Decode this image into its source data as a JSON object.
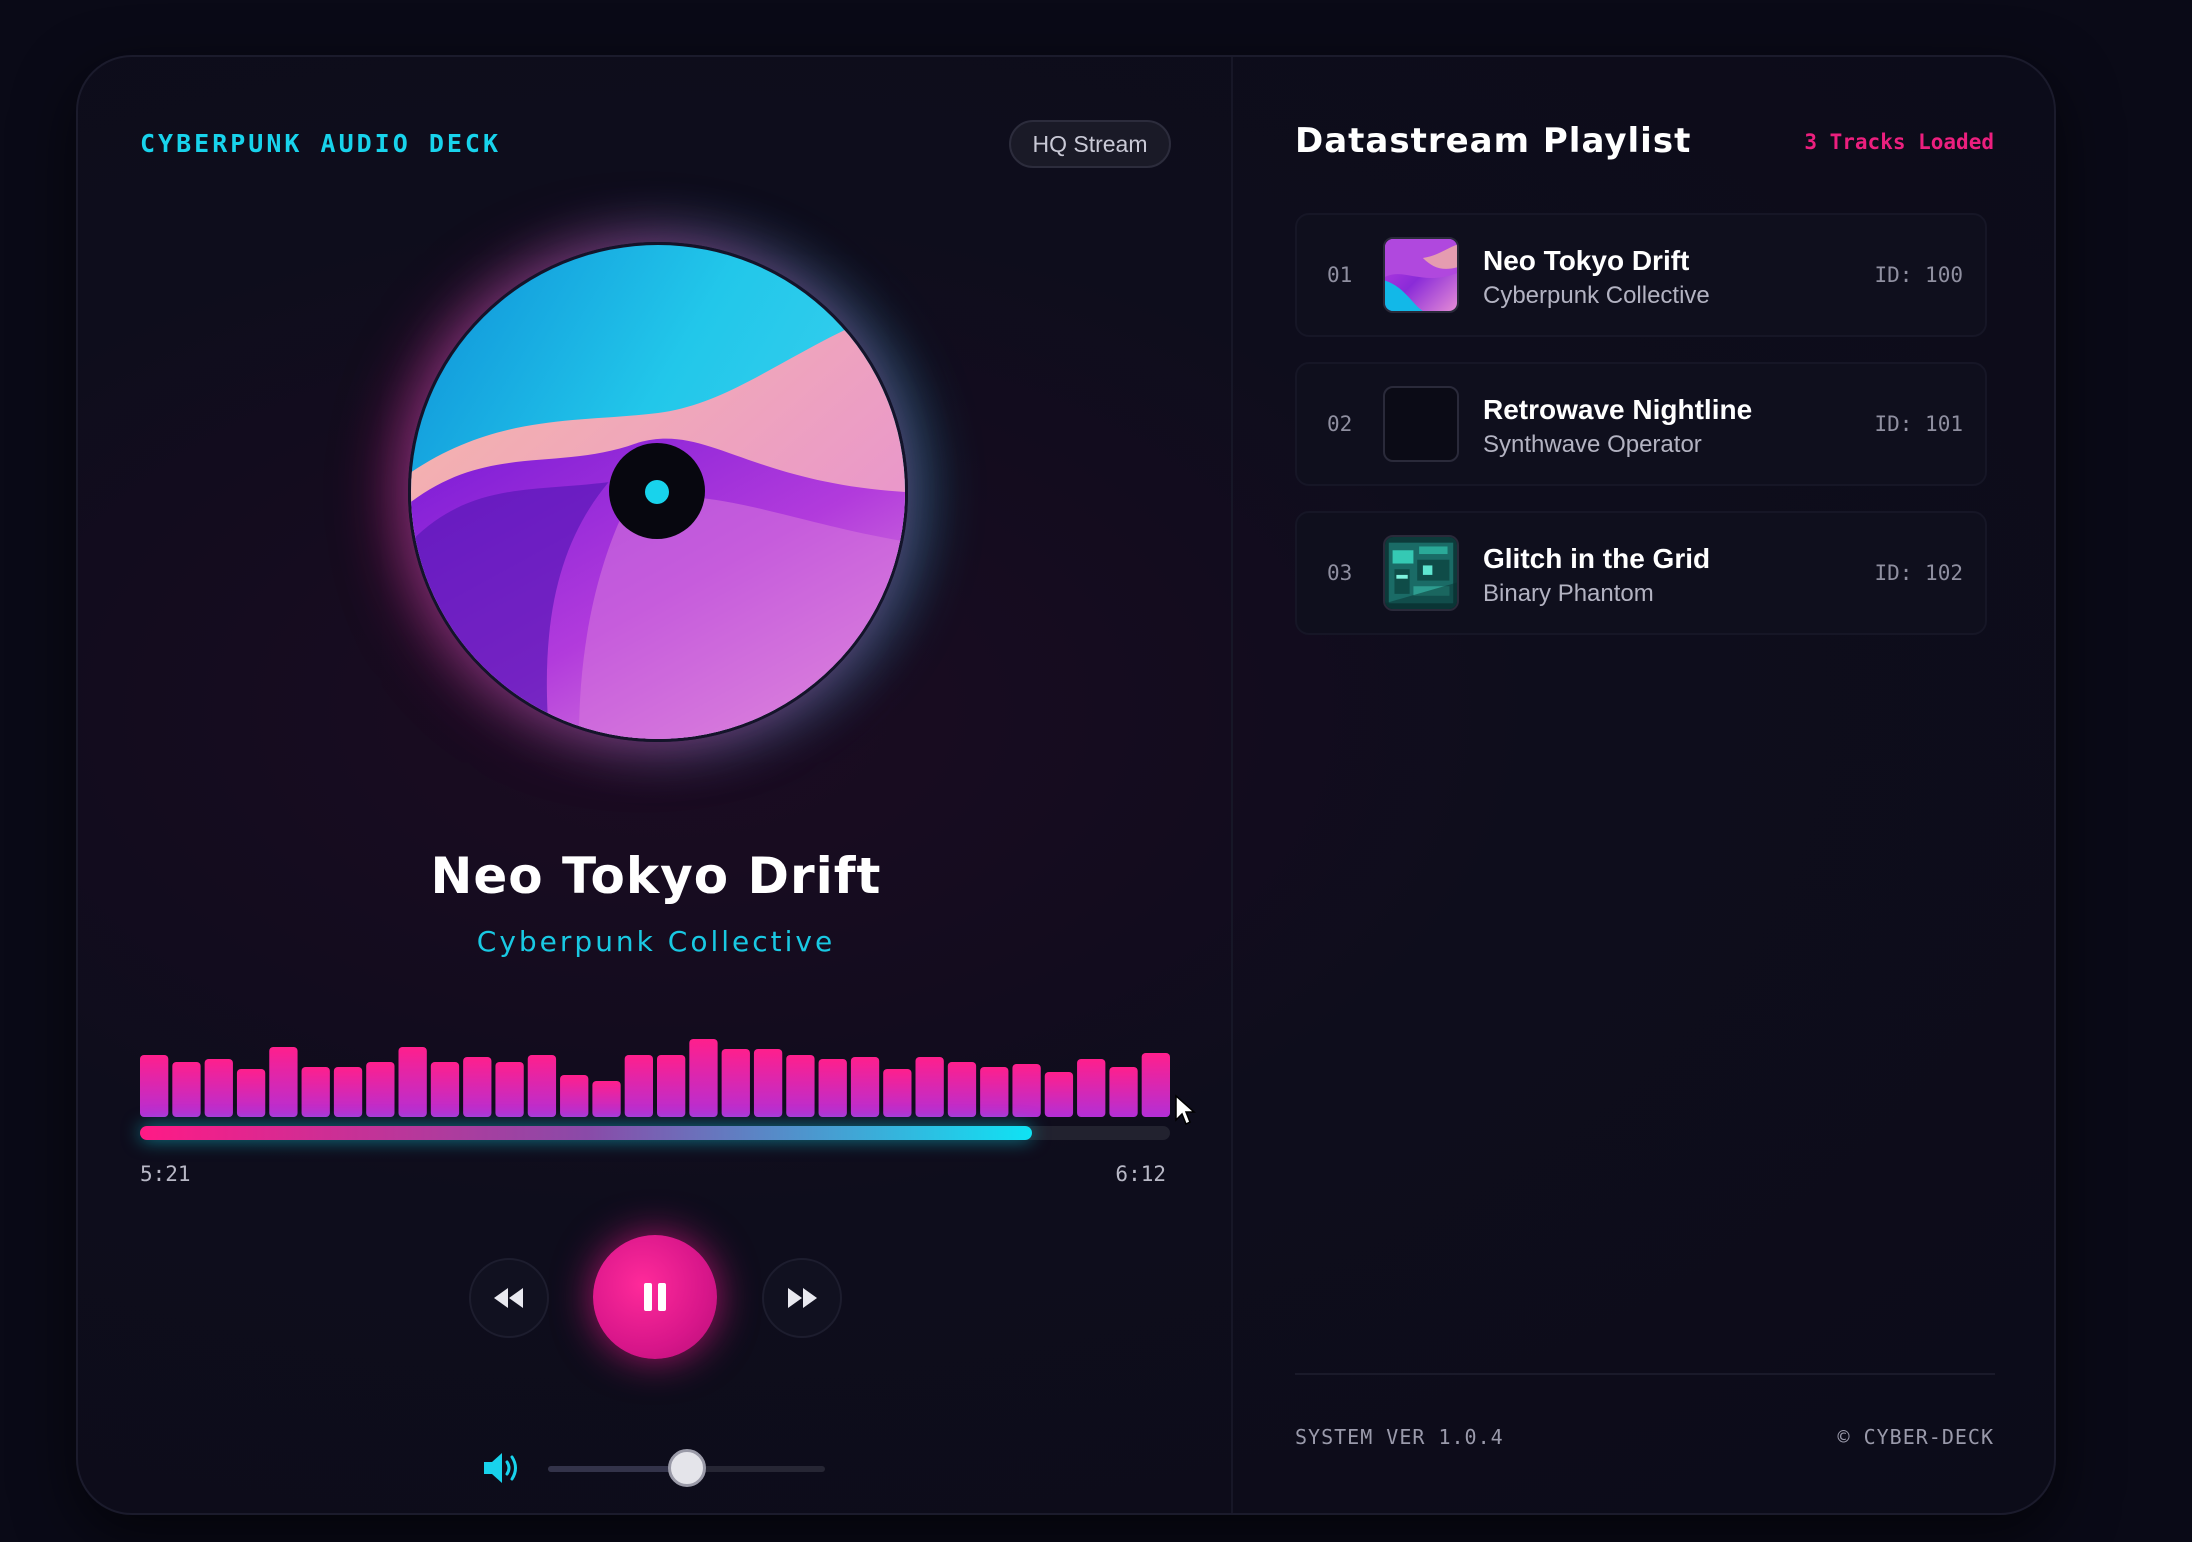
{
  "header": {
    "brand": "CYBERPUNK AUDIO DECK",
    "quality_badge": "HQ Stream"
  },
  "now_playing": {
    "title": "Neo Tokyo Drift",
    "artist": "Cyberpunk Collective",
    "current_time": "5:21",
    "duration": "6:12",
    "progress_fraction": 0.866,
    "state": "playing"
  },
  "visualizer": {
    "bar_levels": [
      0.62,
      0.55,
      0.58,
      0.48,
      0.7,
      0.5,
      0.5,
      0.55,
      0.7,
      0.55,
      0.6,
      0.55,
      0.62,
      0.42,
      0.36,
      0.62,
      0.62,
      0.78,
      0.68,
      0.68,
      0.62,
      0.58,
      0.6,
      0.48,
      0.6,
      0.55,
      0.5,
      0.53,
      0.45,
      0.58,
      0.5,
      0.64
    ]
  },
  "controls": {
    "previous": "rewind-icon",
    "play_pause": "pause-icon",
    "next": "fast-forward-icon"
  },
  "volume": {
    "icon": "speaker-icon",
    "level_fraction": 0.5
  },
  "playlist": {
    "title": "Datastream Playlist",
    "count_label": "3 Tracks Loaded",
    "tracks": [
      {
        "num": "01",
        "title": "Neo Tokyo Drift",
        "artist": "Cyberpunk Collective",
        "id": "ID: 100"
      },
      {
        "num": "02",
        "title": "Retrowave Nightline",
        "artist": "Synthwave Operator",
        "id": "ID: 101"
      },
      {
        "num": "03",
        "title": "Glitch in the Grid",
        "artist": "Binary Phantom",
        "id": "ID: 102"
      }
    ]
  },
  "footer": {
    "version": "SYSTEM VER 1.0.4",
    "copyright": "© CYBER-DECK"
  },
  "colors": {
    "accent_cyan": "#18d3ec",
    "accent_pink": "#ec1f7e",
    "background": "#0a0a17"
  }
}
